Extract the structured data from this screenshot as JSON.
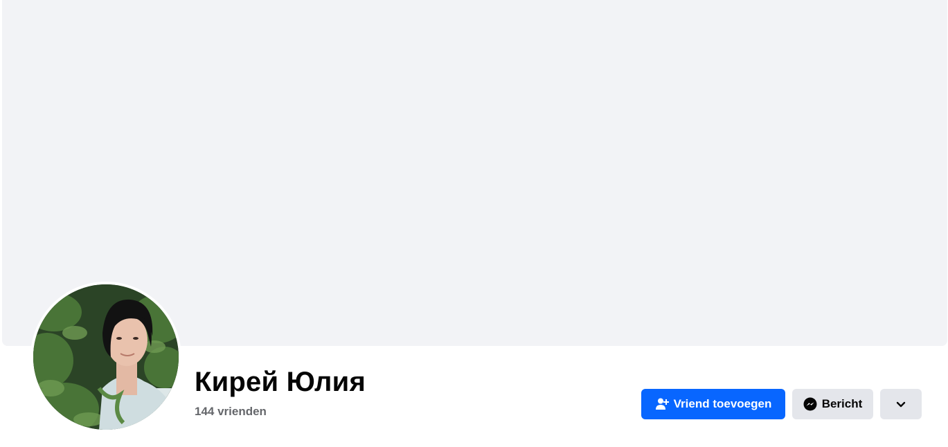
{
  "profile": {
    "name": "Кирей Юлия",
    "friends_count": "144 vrienden"
  },
  "actions": {
    "add_friend_label": "Vriend toevoegen",
    "message_label": "Bericht"
  },
  "icons": {
    "add_friend": "person-add-icon",
    "message": "messenger-icon",
    "more": "chevron-down-icon"
  },
  "colors": {
    "primary": "#0866ff",
    "secondary_button": "#e4e6eb",
    "cover": "#f2f3f6",
    "name_text": "#050505",
    "muted_text": "#65676b"
  }
}
